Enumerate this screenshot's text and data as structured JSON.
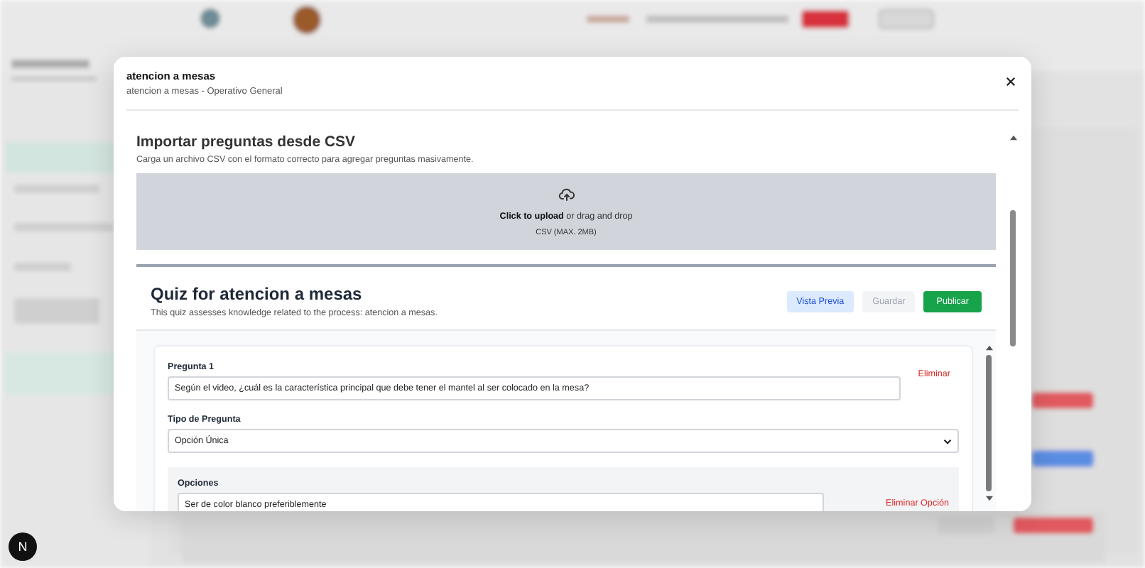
{
  "dialog": {
    "title": "atencion a mesas",
    "subtitle": "atencion a mesas - Operativo General"
  },
  "csv_import": {
    "title": "Importar preguntas desde CSV",
    "description": "Carga un archivo CSV con el formato correcto para agregar preguntas masivamente.",
    "upload_text": "**Click to upload** or drag and drop",
    "upload_hint": "CSV (MAX. 2MB)"
  },
  "quiz": {
    "title": "Quiz for atencion a mesas",
    "description": "This quiz assesses knowledge related to the process: atencion a mesas.",
    "buttons": [
      {
        "label": "Vista Previa",
        "kind": "preview",
        "disabled": false
      },
      {
        "label": "Guardar",
        "kind": "save",
        "disabled": true
      },
      {
        "label": "Publicar",
        "kind": "publish",
        "disabled": false
      }
    ],
    "questions": [
      {
        "label": "Pregunta 1",
        "text": "Según el video, ¿cuál es la característica principal que debe tener el mantel al ser colocado en la mesa?",
        "delete_label": "Eliminar",
        "type_label": "Tipo de Pregunta",
        "type_value": "Opción Única",
        "options_label": "Opciones",
        "options": [
          {
            "text": "Ser de color blanco preferiblemente",
            "delete_label": "Eliminar Opción"
          }
        ]
      }
    ]
  },
  "dev_badge": "N"
}
